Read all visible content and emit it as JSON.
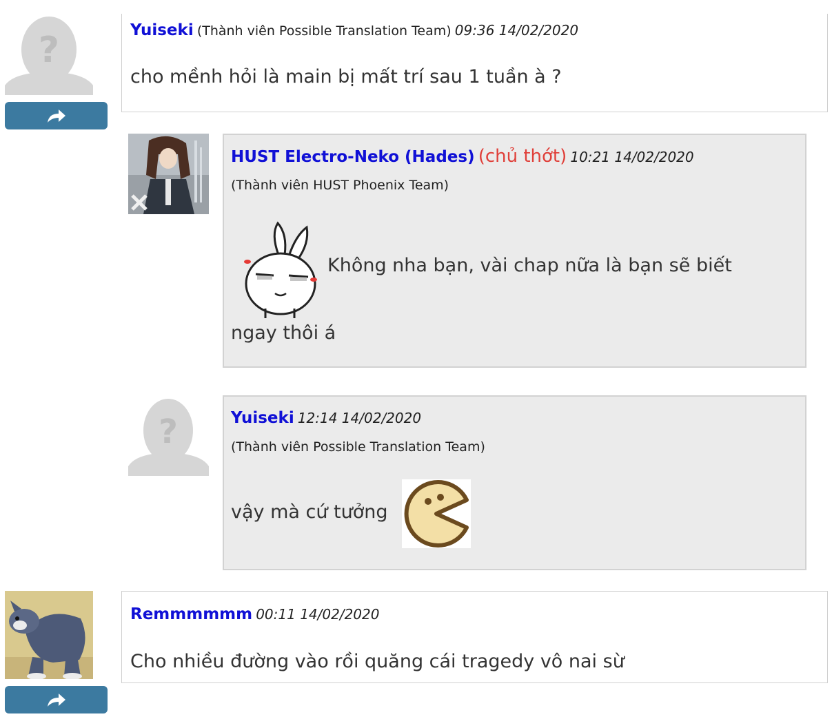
{
  "comments": [
    {
      "author": "Yuiseki",
      "team": "(Thành viên Possible Translation Team)",
      "time": "09:36 14/02/2020",
      "text": "cho mềnh hỏi là main bị mất trí sau 1 tuần à ?",
      "replies": [
        {
          "author": "HUST Electro-Neko (Hades)",
          "owner_badge": "(chủ thớt)",
          "time": "10:21 14/02/2020",
          "team": "(Thành viên HUST Phoenix Team)",
          "text_line1": "Không nha bạn, vài chap nữa là bạn sẽ biết",
          "text_line2": "ngay thôi á"
        },
        {
          "author": "Yuiseki",
          "time": "12:14 14/02/2020",
          "team": "(Thành viên Possible Translation Team)",
          "text": "vậy mà cứ tưởng"
        }
      ]
    },
    {
      "author": "Remmmmmm",
      "time": "00:11 14/02/2020",
      "text": "Cho nhiều đường vào rồi quăng cái tragedy vô nai sừ"
    }
  ],
  "icons": {
    "reply": "share-arrow-icon",
    "placeholder_avatar": "user-placeholder-icon",
    "emoji_rabbit": "rabbit-emoticon",
    "emoji_pacman": "pacman-emoticon"
  },
  "colors": {
    "author_link": "#1010d6",
    "owner_badge": "#e0403a",
    "reply_button": "#3c7aa0",
    "reply_card_bg": "#ebebeb"
  }
}
